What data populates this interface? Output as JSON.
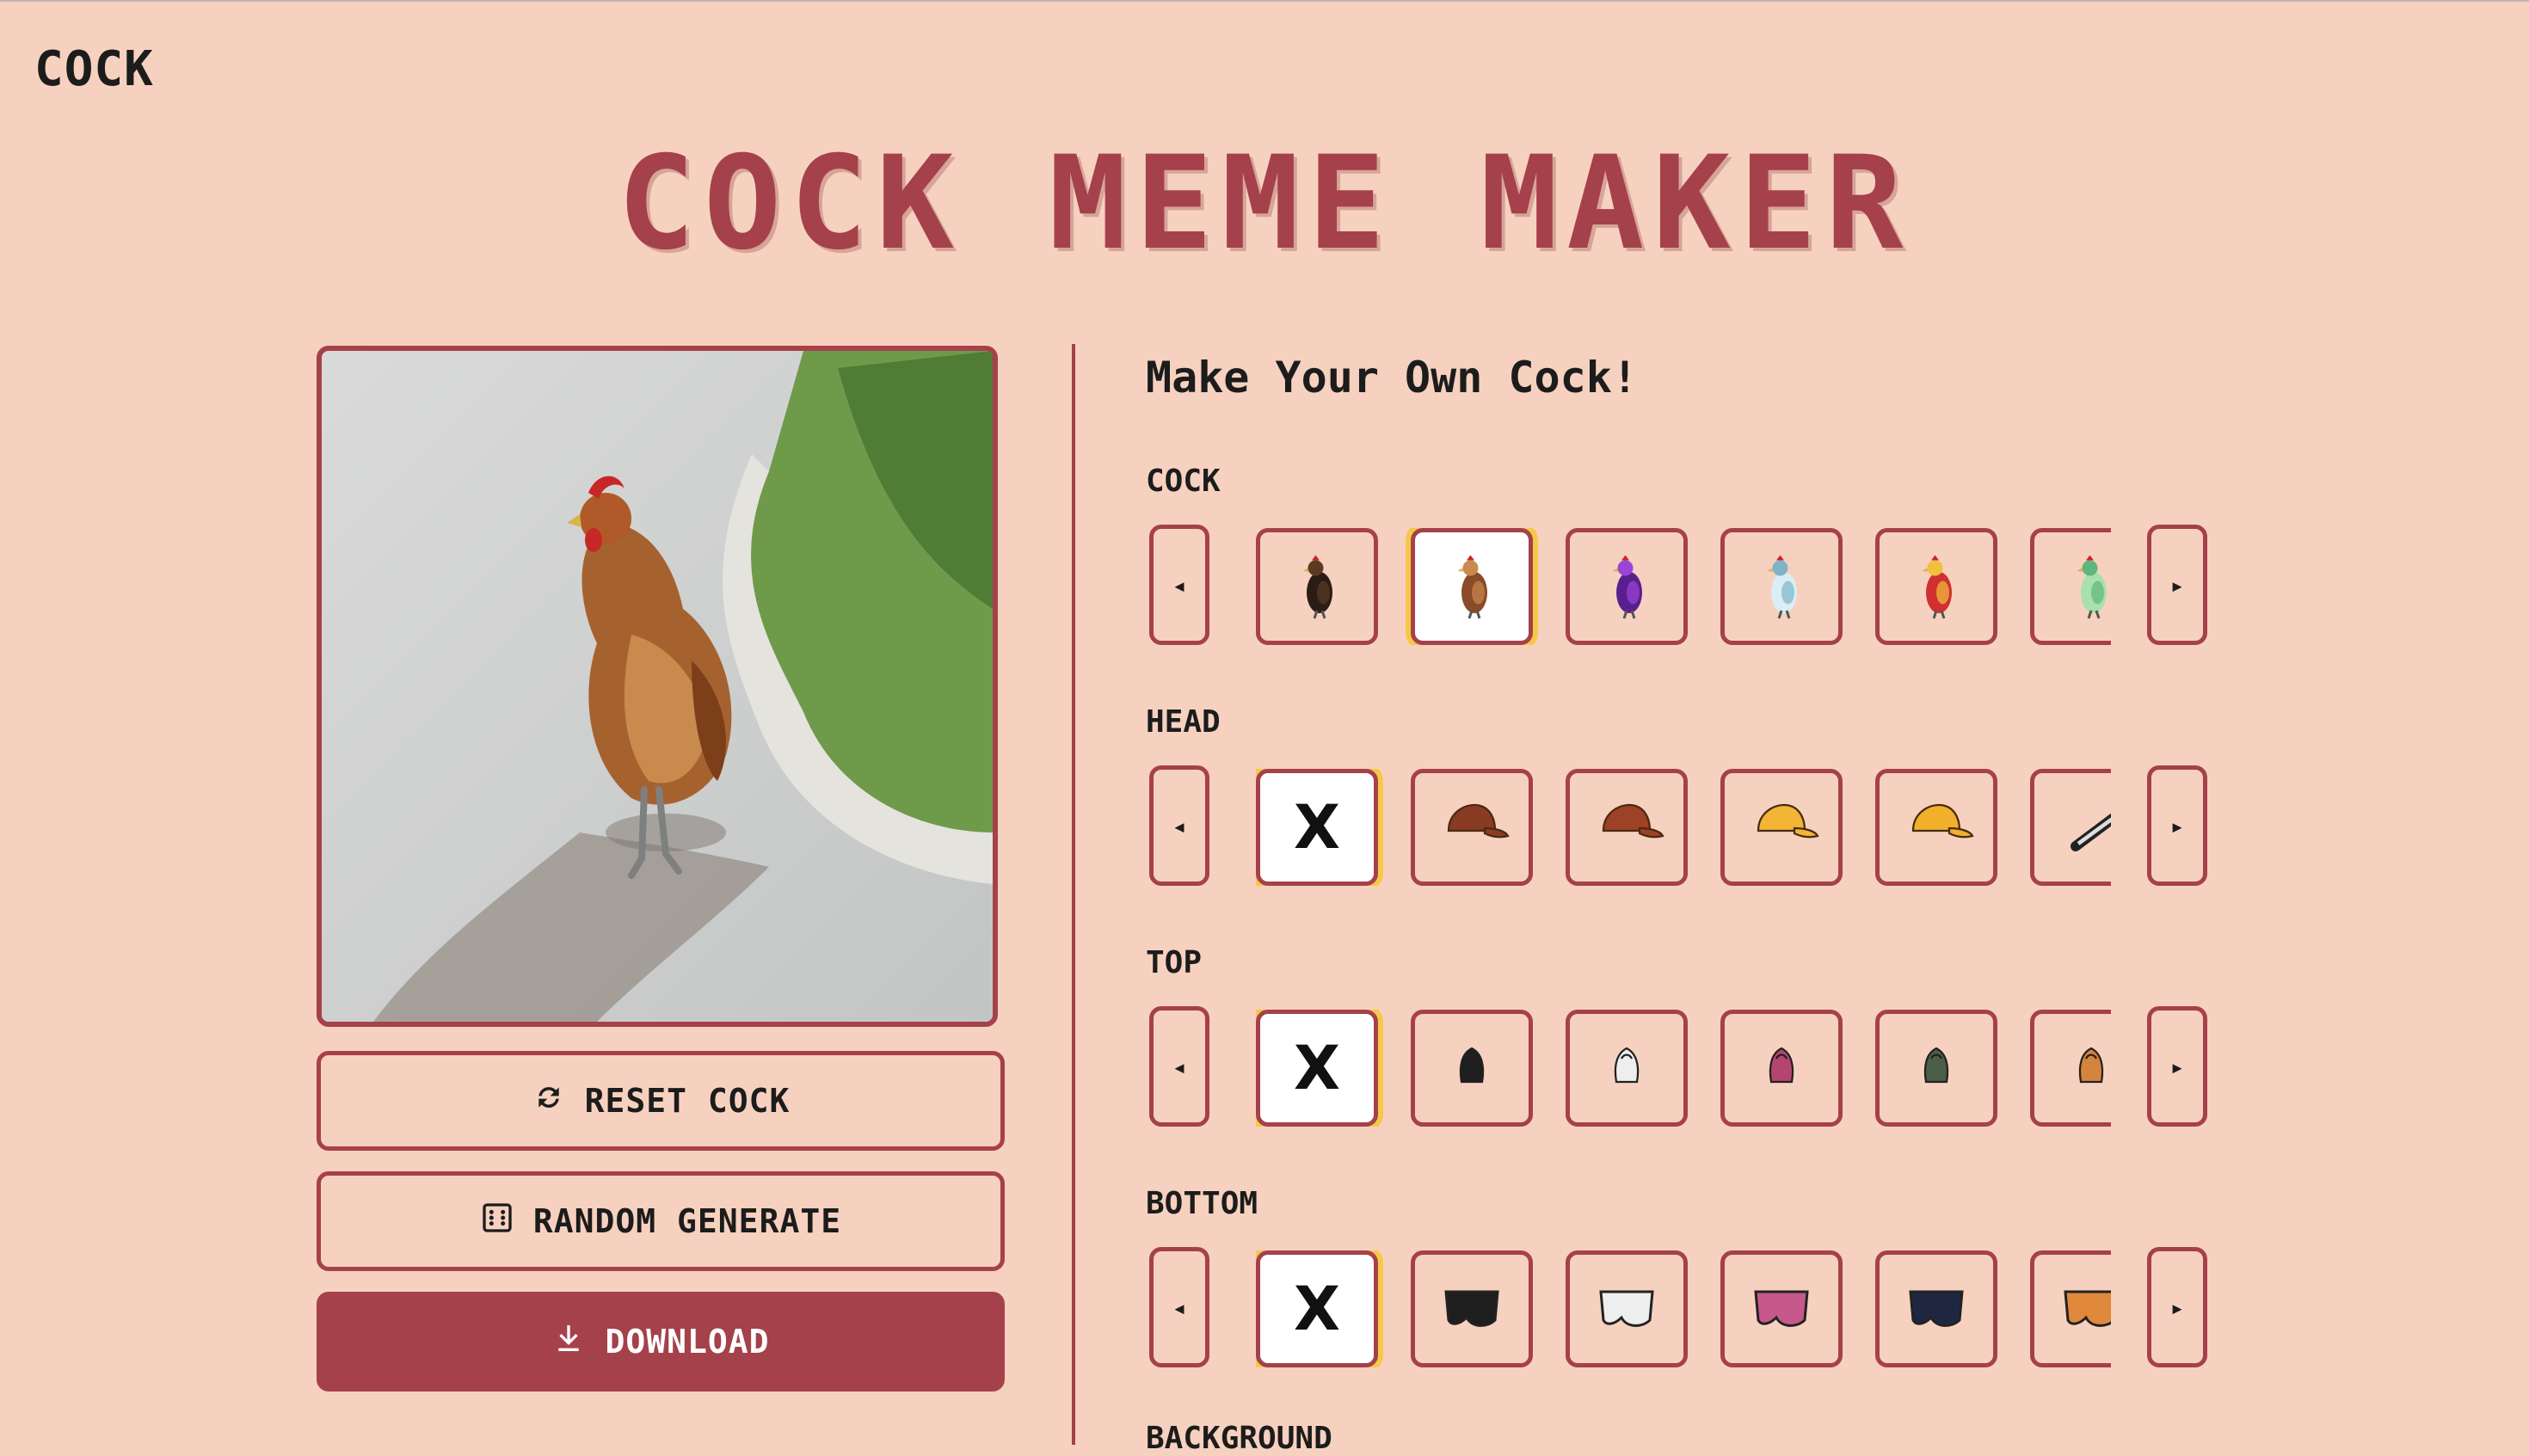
{
  "header": {
    "logo": "COCK",
    "title": "COCK MEME MAKER"
  },
  "actions": {
    "reset_label": "RESET COCK",
    "random_label": "RANDOM GENERATE",
    "download_label": "DOWNLOAD"
  },
  "panel": {
    "title": "Make Your Own Cock!",
    "sections": [
      {
        "label": "COCK",
        "items": [
          "rooster-black",
          "rooster-brown",
          "rooster-purple",
          "rooster-white",
          "rooster-red-yellow",
          "rooster-green"
        ],
        "selected": 1
      },
      {
        "label": "HEAD",
        "items": [
          "none",
          "cap-brown",
          "cap-brown-2",
          "cap-yellow",
          "cap-yellow-2",
          "headphones"
        ],
        "selected": 0
      },
      {
        "label": "TOP",
        "items": [
          "none",
          "hoodie-black",
          "hoodie-white",
          "hoodie-pink",
          "hoodie-green",
          "jacket-orange"
        ],
        "selected": 0
      },
      {
        "label": "BOTTOM",
        "items": [
          "none",
          "shorts-black",
          "shorts-white",
          "shorts-pink",
          "shorts-navy",
          "shorts-orange"
        ],
        "selected": 0
      }
    ],
    "next_section_label": "BACKGROUND",
    "none_label": "X",
    "prev_arrow": "◂",
    "next_arrow": "▸"
  },
  "colors": {
    "accent": "#a5414a",
    "background": "#f7d1bf",
    "highlight": "#f5c84a"
  }
}
